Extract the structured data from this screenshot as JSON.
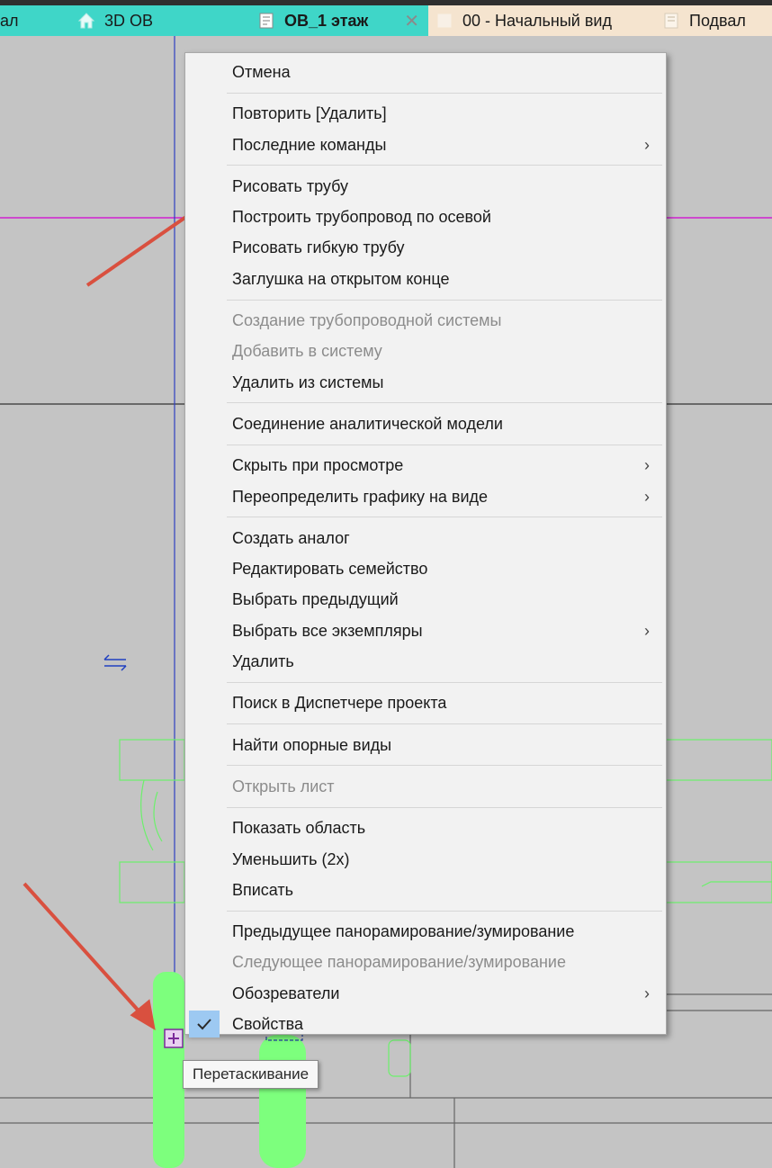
{
  "tabs": [
    {
      "label": "ал",
      "style": "teal"
    },
    {
      "label": "3D ОВ",
      "style": "teal",
      "icon": "home-icon"
    },
    {
      "label": "ОВ_1 этаж",
      "style": "teal",
      "icon": "floorplan-icon",
      "active": true,
      "close": "✕"
    },
    {
      "label": "00 - Начальный вид",
      "style": "beige",
      "icon": "view-icon"
    },
    {
      "label": "Подвал",
      "style": "beige",
      "icon": "floorplan-icon"
    }
  ],
  "menu": {
    "items": [
      {
        "label": "Отмена"
      },
      {
        "separator": true
      },
      {
        "label": "Повторить [Удалить]"
      },
      {
        "label": "Последние команды",
        "submenu": true
      },
      {
        "separator": true
      },
      {
        "label": "Рисовать трубу"
      },
      {
        "label": "Построить трубопровод по осевой"
      },
      {
        "label": "Рисовать гибкую трубу"
      },
      {
        "label": "Заглушка на открытом конце"
      },
      {
        "separator": true
      },
      {
        "label": "Создание трубопроводной системы",
        "disabled": true
      },
      {
        "label": "Добавить в систему",
        "disabled": true
      },
      {
        "label": "Удалить из системы"
      },
      {
        "separator": true
      },
      {
        "label": "Соединение аналитической модели"
      },
      {
        "separator": true
      },
      {
        "label": "Скрыть при просмотре",
        "submenu": true
      },
      {
        "label": "Переопределить графику на виде",
        "submenu": true
      },
      {
        "separator": true
      },
      {
        "label": "Создать аналог"
      },
      {
        "label": "Редактировать семейство"
      },
      {
        "label": "Выбрать предыдущий"
      },
      {
        "label": "Выбрать все экземпляры",
        "submenu": true
      },
      {
        "label": "Удалить"
      },
      {
        "separator": true
      },
      {
        "label": "Поиск в Диспетчере проекта"
      },
      {
        "separator": true
      },
      {
        "label": "Найти опорные виды"
      },
      {
        "separator": true
      },
      {
        "label": "Открыть лист",
        "disabled": true
      },
      {
        "separator": true
      },
      {
        "label": "Показать область"
      },
      {
        "label": "Уменьшить (2x)"
      },
      {
        "label": "Вписать"
      },
      {
        "separator": true
      },
      {
        "label": "Предыдущее панорамирование/зумирование"
      },
      {
        "label": "Следующее панорамирование/зумирование",
        "disabled": true
      },
      {
        "label": "Обозреватели",
        "submenu": true
      },
      {
        "label": "Свойства",
        "checked": true
      }
    ]
  },
  "tooltip": "Перетаскивание",
  "colors": {
    "tab_teal": "#3fd6c8",
    "tab_beige": "#f5e4cf",
    "canvas": "#c4c4c4",
    "magenta_line": "#d020d0",
    "blue_line": "#3040c0",
    "green_geometry": "#7dff7d",
    "arrow": "#d9503f",
    "check_bg": "#9dc9f2"
  }
}
